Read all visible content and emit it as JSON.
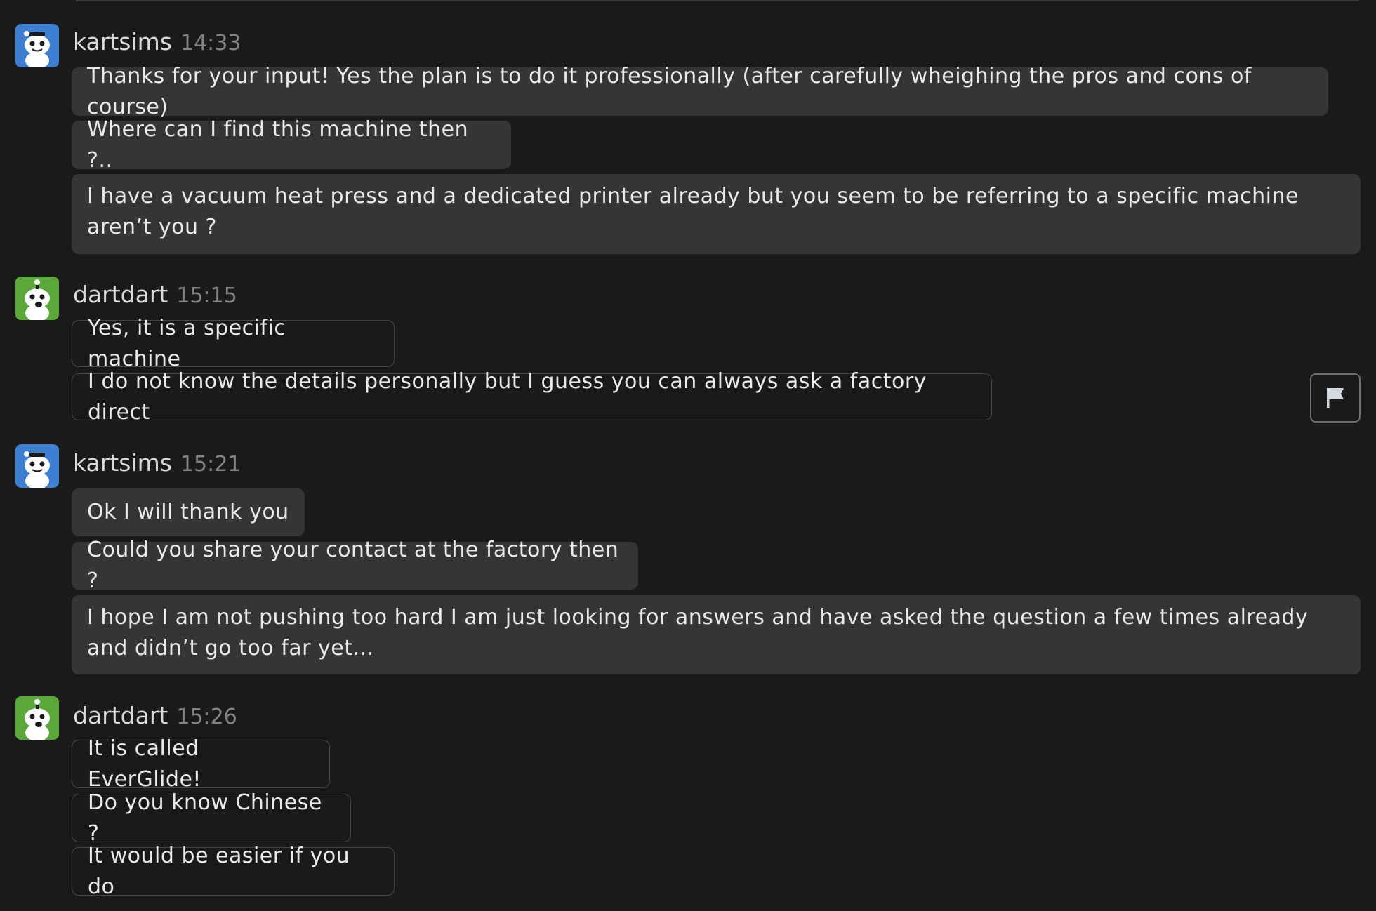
{
  "messages": [
    {
      "username": "kartsims",
      "time": "14:33",
      "lines": [
        "Thanks for your input! Yes the plan is to do it professionally (after carefully wheighing the pros and cons of course)",
        "Where can I find this machine then ?..",
        "I have a vacuum heat press and a dedicated printer already but you seem to be referring to a specific machine aren’t you ?"
      ]
    },
    {
      "username": "dartdart",
      "time": "15:15",
      "lines": [
        "Yes, it is a specific machine",
        "I do not know the details personally but I guess you can always ask a factory direct"
      ]
    },
    {
      "username": "kartsims",
      "time": "15:21",
      "lines": [
        "Ok I will thank you",
        "Could you share your contact at the factory then ?",
        "I hope I am not pushing too hard I am just looking for answers and have asked the question a few times already and didn’t go too far yet..."
      ]
    },
    {
      "username": "dartdart",
      "time": "15:26",
      "lines": [
        "It is called EverGlide!",
        "Do you know Chinese ?",
        "It would be easier if you do"
      ]
    }
  ],
  "flag_icon": "flag-icon",
  "colors": {
    "background": "#1a1a1b",
    "self_bubble": "#343536",
    "avatar_blue": "#3d7fd1",
    "avatar_green": "#5aa83a"
  }
}
